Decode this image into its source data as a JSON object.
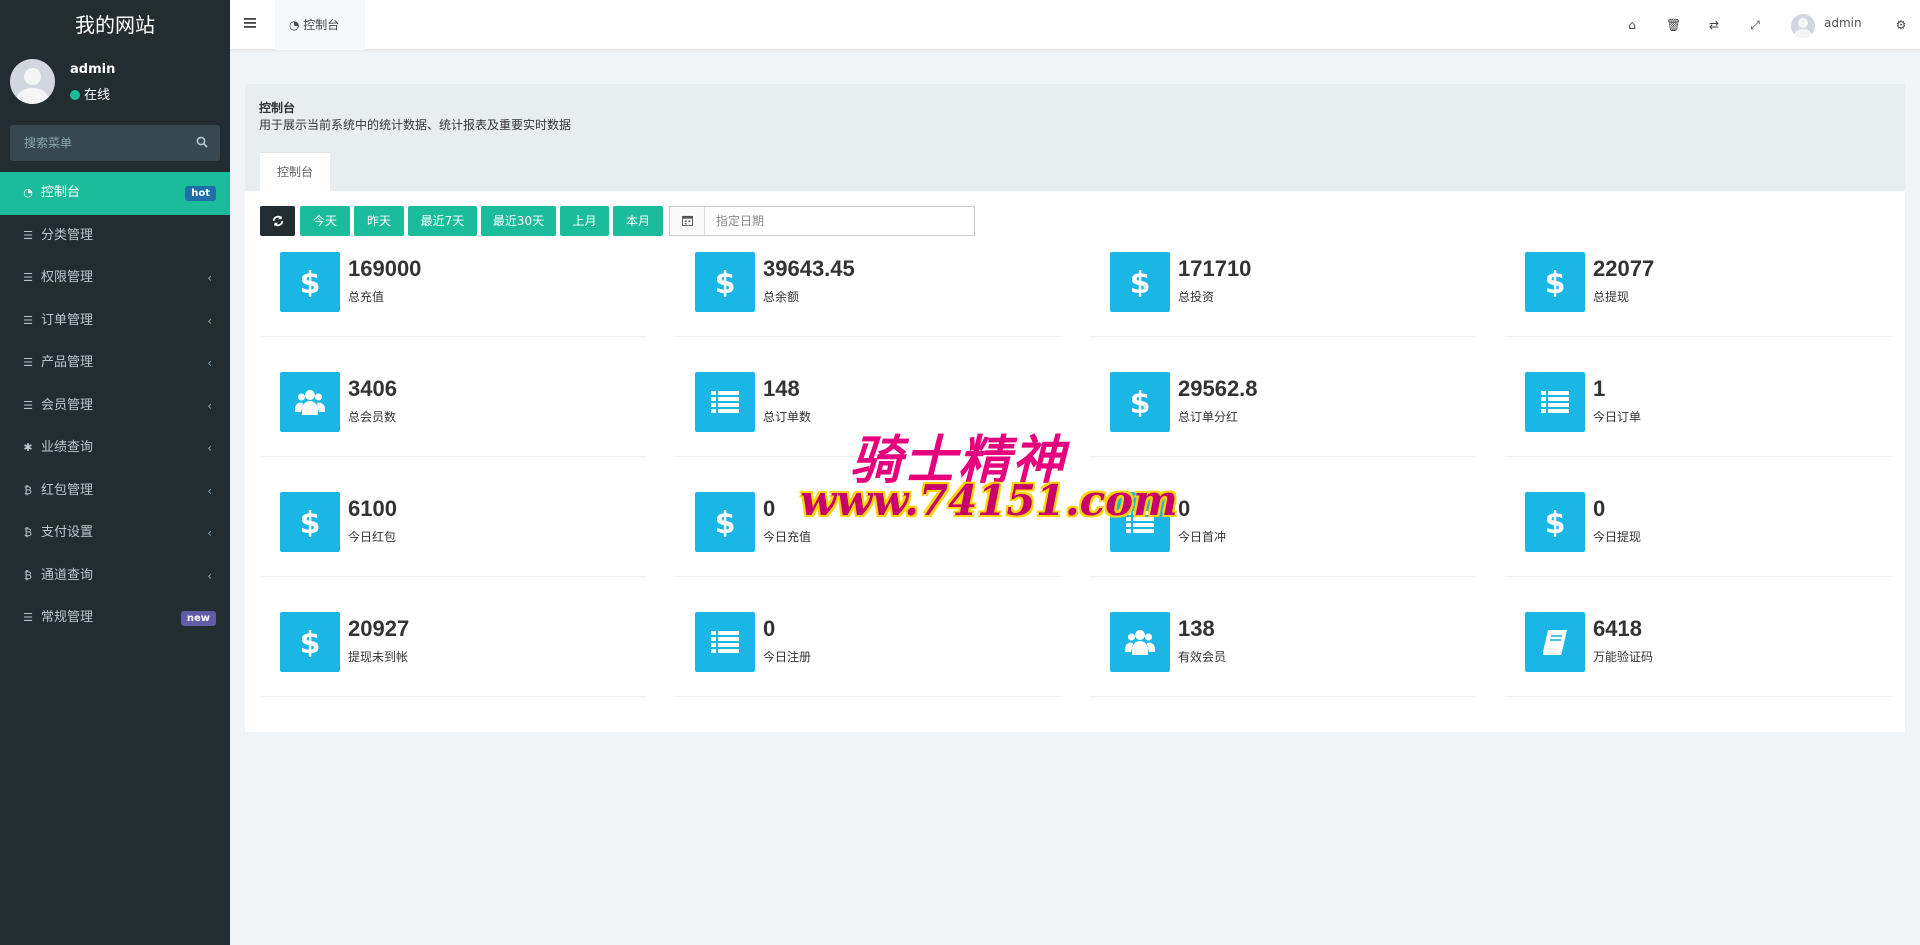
{
  "sidebar": {
    "brand": "我的网站",
    "user_name": "admin",
    "user_status": "在线",
    "search_placeholder": "搜索菜单",
    "items": [
      {
        "label": "控制台",
        "icon": "dashboard-icon",
        "badge": "hot"
      },
      {
        "label": "分类管理",
        "icon": "list-icon"
      },
      {
        "label": "权限管理",
        "icon": "list-icon"
      },
      {
        "label": "订单管理",
        "icon": "list-icon"
      },
      {
        "label": "产品管理",
        "icon": "list-icon"
      },
      {
        "label": "会员管理",
        "icon": "list-icon"
      },
      {
        "label": "业绩查询",
        "icon": "asterisk-icon"
      },
      {
        "label": "红包管理",
        "icon": "bitcoin-icon"
      },
      {
        "label": "支付设置",
        "icon": "bitcoin-icon"
      },
      {
        "label": "通道查询",
        "icon": "bitcoin-icon"
      },
      {
        "label": "常规管理",
        "icon": "list-icon",
        "badge": "new"
      }
    ]
  },
  "header": {
    "tab_label": "控制台",
    "user_name": "admin"
  },
  "panel": {
    "title": "控制台",
    "description": "用于展示当前系统中的统计数据、统计报表及重要实时数据",
    "tab": "控制台"
  },
  "toolbar": {
    "buttons": [
      "今天",
      "昨天",
      "最近7天",
      "最近30天",
      "上月",
      "本月"
    ],
    "date_placeholder": "指定日期"
  },
  "stats": [
    {
      "value": "169000",
      "label": "总充值",
      "icon": "dollar-icon"
    },
    {
      "value": "39643.45",
      "label": "总余额",
      "icon": "dollar-icon"
    },
    {
      "value": "171710",
      "label": "总投资",
      "icon": "dollar-icon"
    },
    {
      "value": "22077",
      "label": "总提现",
      "icon": "dollar-icon"
    },
    {
      "value": "3406",
      "label": "总会员数",
      "icon": "users-icon"
    },
    {
      "value": "148",
      "label": "总订单数",
      "icon": "list-icon"
    },
    {
      "value": "29562.8",
      "label": "总订单分红",
      "icon": "dollar-icon"
    },
    {
      "value": "1",
      "label": "今日订单",
      "icon": "list-icon"
    },
    {
      "value": "6100",
      "label": "今日红包",
      "icon": "dollar-icon"
    },
    {
      "value": "0",
      "label": "今日充值",
      "icon": "dollar-icon"
    },
    {
      "value": "0",
      "label": "今日首冲",
      "icon": "list-icon"
    },
    {
      "value": "0",
      "label": "今日提现",
      "icon": "dollar-icon"
    },
    {
      "value": "20927",
      "label": "提现未到帐",
      "icon": "dollar-icon"
    },
    {
      "value": "0",
      "label": "今日注册",
      "icon": "list-icon"
    },
    {
      "value": "138",
      "label": "有效会员",
      "icon": "users-icon"
    },
    {
      "value": "6418",
      "label": "万能验证码",
      "icon": "book-icon"
    }
  ],
  "watermark": {
    "line1": "骑士精神",
    "line2": "www.74151.com"
  },
  "colors": {
    "sidebar_bg": "#222d32",
    "accent": "#1abc9c",
    "stat_icon_bg": "#1ab6e6"
  }
}
